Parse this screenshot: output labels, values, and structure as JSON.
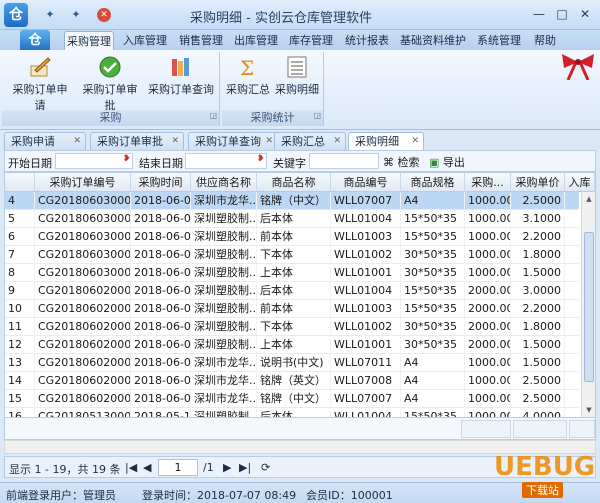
{
  "window": {
    "title": "采购明细 - 实创云仓库管理软件",
    "minimize": "—",
    "maximize": "□",
    "close": "✕"
  },
  "quick_access": {
    "a": "✦",
    "b": "✦",
    "close": "✕"
  },
  "menu_logo": "仓",
  "menu_tabs": [
    "采购管理",
    "入库管理",
    "销售管理",
    "出库管理",
    "库存管理",
    "统计报表",
    "基础资料维护",
    "系统管理",
    "帮助"
  ],
  "ribbon": {
    "group1": {
      "label": "采购",
      "buttons": [
        "采购订单申请",
        "采购订单审批",
        "采购订单查询"
      ]
    },
    "group2": {
      "label": "采购统计",
      "buttons": [
        "采购汇总",
        "采购明细"
      ]
    }
  },
  "doc_tabs": [
    "采购申请",
    "采购订单审批",
    "采购订单查询",
    "采购汇总",
    "采购明细"
  ],
  "filter": {
    "start_label": "开始日期",
    "end_label": "结束日期",
    "keyword_label": "关键字",
    "search_label": "检索",
    "export_label": "导出"
  },
  "grid": {
    "headers": [
      "",
      "采购订单编号",
      "采购时间",
      "供应商名称",
      "商品名称",
      "商品编号",
      "商品规格",
      "采购...",
      "采购单价",
      "入库"
    ],
    "rows": [
      [
        "4",
        "CG201806030002",
        "2018-06-03",
        "深圳市龙华...",
        "铭牌（中文）",
        "WLL07007",
        "A4",
        "1000.00",
        "2.5000"
      ],
      [
        "5",
        "CG201806030001",
        "2018-06-03",
        "深圳塑胶制...",
        "后本体",
        "WLL01004",
        "15*50*35",
        "1000.00",
        "3.1000"
      ],
      [
        "6",
        "CG201806030001",
        "2018-06-03",
        "深圳塑胶制...",
        "前本体",
        "WLL01003",
        "15*50*35",
        "1000.00",
        "2.2000"
      ],
      [
        "7",
        "CG201806030001",
        "2018-06-03",
        "深圳塑胶制...",
        "下本体",
        "WLL01002",
        "30*50*35",
        "1000.00",
        "1.8000"
      ],
      [
        "8",
        "CG201806030001",
        "2018-06-03",
        "深圳塑胶制...",
        "上本体",
        "WLL01001",
        "30*50*35",
        "1000.00",
        "1.5000"
      ],
      [
        "9",
        "CG201806020002",
        "2018-06-02",
        "深圳塑胶制...",
        "后本体",
        "WLL01004",
        "15*50*35",
        "2000.00",
        "3.0000"
      ],
      [
        "10",
        "CG201806020002",
        "2018-06-02",
        "深圳塑胶制...",
        "前本体",
        "WLL01003",
        "15*50*35",
        "2000.00",
        "2.2000"
      ],
      [
        "11",
        "CG201806020002",
        "2018-06-02",
        "深圳塑胶制...",
        "下本体",
        "WLL01002",
        "30*50*35",
        "2000.00",
        "1.8000"
      ],
      [
        "12",
        "CG201806020002",
        "2018-06-02",
        "深圳塑胶制...",
        "上本体",
        "WLL01001",
        "30*50*35",
        "2000.00",
        "1.5000"
      ],
      [
        "13",
        "CG201806020001",
        "2018-06-02",
        "深圳市龙华...",
        "说明书(中文)",
        "WLL07011",
        "A4",
        "1000.00",
        "1.5000"
      ],
      [
        "14",
        "CG201806020001",
        "2018-06-02",
        "深圳市龙华...",
        "铭牌（英文）",
        "WLL07008",
        "A4",
        "1000.00",
        "2.5000"
      ],
      [
        "15",
        "CG201806020001",
        "2018-06-02",
        "深圳市龙华...",
        "铭牌（中文）",
        "WLL07007",
        "A4",
        "1000.00",
        "2.5000"
      ],
      [
        "16",
        "CG201805130001",
        "2018-05-13",
        "深圳塑胶制...",
        "后本体",
        "WLL01004",
        "15*50*35",
        "1000.00",
        "4.0000"
      ]
    ]
  },
  "pager": {
    "info": "显示 1 - 19，共 19 条",
    "page": "1",
    "total": "/1"
  },
  "status": {
    "user": "前端登录用户：管理员",
    "time": "登录时间：2018-07-07 08:49",
    "member": "会员ID：100001"
  },
  "watermark": {
    "text": "UEBUG",
    "subtext": "下载站"
  },
  "colors": {
    "accent": "#1d6cc2",
    "selected_row": "#bcd8f4"
  }
}
